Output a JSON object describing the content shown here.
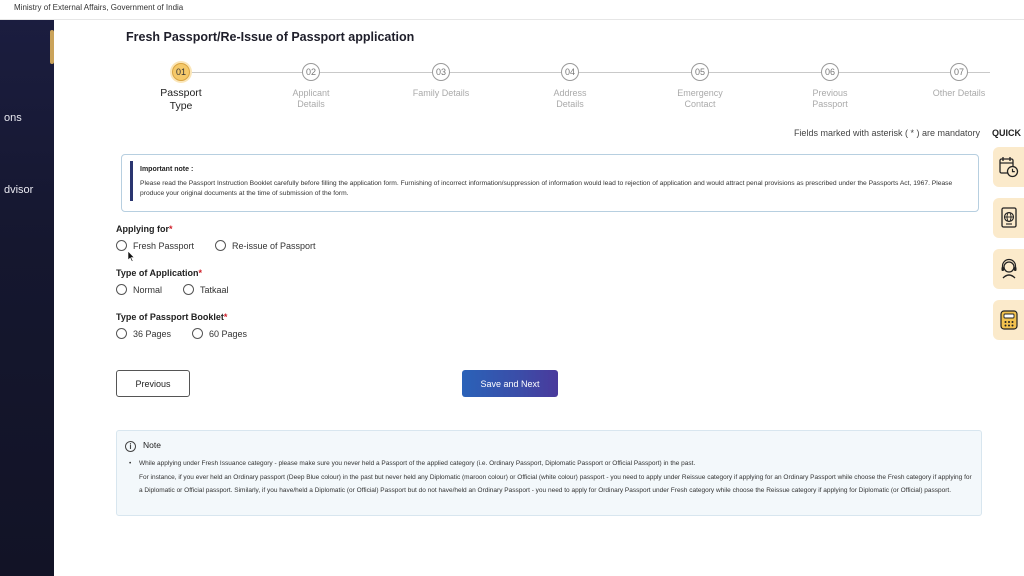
{
  "topbar": {
    "ministry": "Ministry of External Affairs, Government of India"
  },
  "sidebar": {
    "items": [
      {
        "label": "ons"
      },
      {
        "label": "dvisor"
      }
    ]
  },
  "page": {
    "title": "Fresh Passport/Re-Issue of Passport application"
  },
  "stepper": {
    "steps": [
      {
        "num": "01",
        "label": "Passport Type",
        "active": true
      },
      {
        "num": "02",
        "label": "Applicant Details"
      },
      {
        "num": "03",
        "label": "Family Details"
      },
      {
        "num": "04",
        "label": "Address Details"
      },
      {
        "num": "05",
        "label": "Emergency Contact"
      },
      {
        "num": "06",
        "label": "Previous Passport"
      },
      {
        "num": "07",
        "label": "Other Details"
      }
    ]
  },
  "mandatory_note": "Fields marked with asterisk ( * ) are mandatory",
  "important_note": {
    "title": "Important note :",
    "body": "Please read the Passport Instruction Booklet carefully before filling the application form. Furnishing of incorrect information/suppression of information would lead to rejection of application and would attract penal provisions as prescribed under the Passports Act, 1967. Please produce your original documents at the time of submission of the form."
  },
  "form": {
    "applying_for": {
      "label": "Applying for",
      "options": [
        "Fresh Passport",
        "Re-issue of Passport"
      ]
    },
    "application_type": {
      "label": "Type of Application",
      "options": [
        "Normal",
        "Tatkaal"
      ]
    },
    "booklet_type": {
      "label": "Type of Passport Booklet",
      "options": [
        "36 Pages",
        "60 Pages"
      ]
    },
    "asterisk": "*"
  },
  "buttons": {
    "previous": "Previous",
    "save_next": "Save and Next"
  },
  "note": {
    "icon_glyph": "i",
    "title": "Note",
    "bullet": "While applying under Fresh Issuance category - please make sure you never held a Passport of the applied category (i.e. Ordinary Passport, Diplomatic Passport or Official Passport) in the past.",
    "detail": "For instance, if you ever held an Ordinary passport (Deep Blue colour) in the past but never held any Diplomatic (maroon colour) or Official (white colour) passport - you need to apply under Reissue category if applying for an Ordinary Passport while choose the Fresh category if applying for a Diplomatic or Official passport. Similarly, if you have/held a Diplomatic (or Official) Passport but do not have/held an Ordinary Passport - you need to apply for Ordinary Passport under Fresh category while choose the Reissue category if applying for Diplomatic (or Official) passport."
  },
  "quick_links": {
    "title": "QUICK L",
    "icons": [
      "calendar-clock-icon",
      "passport-globe-icon",
      "support-agent-icon",
      "fee-calculator-icon"
    ]
  },
  "colors": {
    "active_step": "#f5c96a",
    "primary_button": "#2a62b8",
    "sidebar": "#1b1d3f",
    "quick_link_bg": "#fbeacb",
    "required": "#d0202a"
  }
}
